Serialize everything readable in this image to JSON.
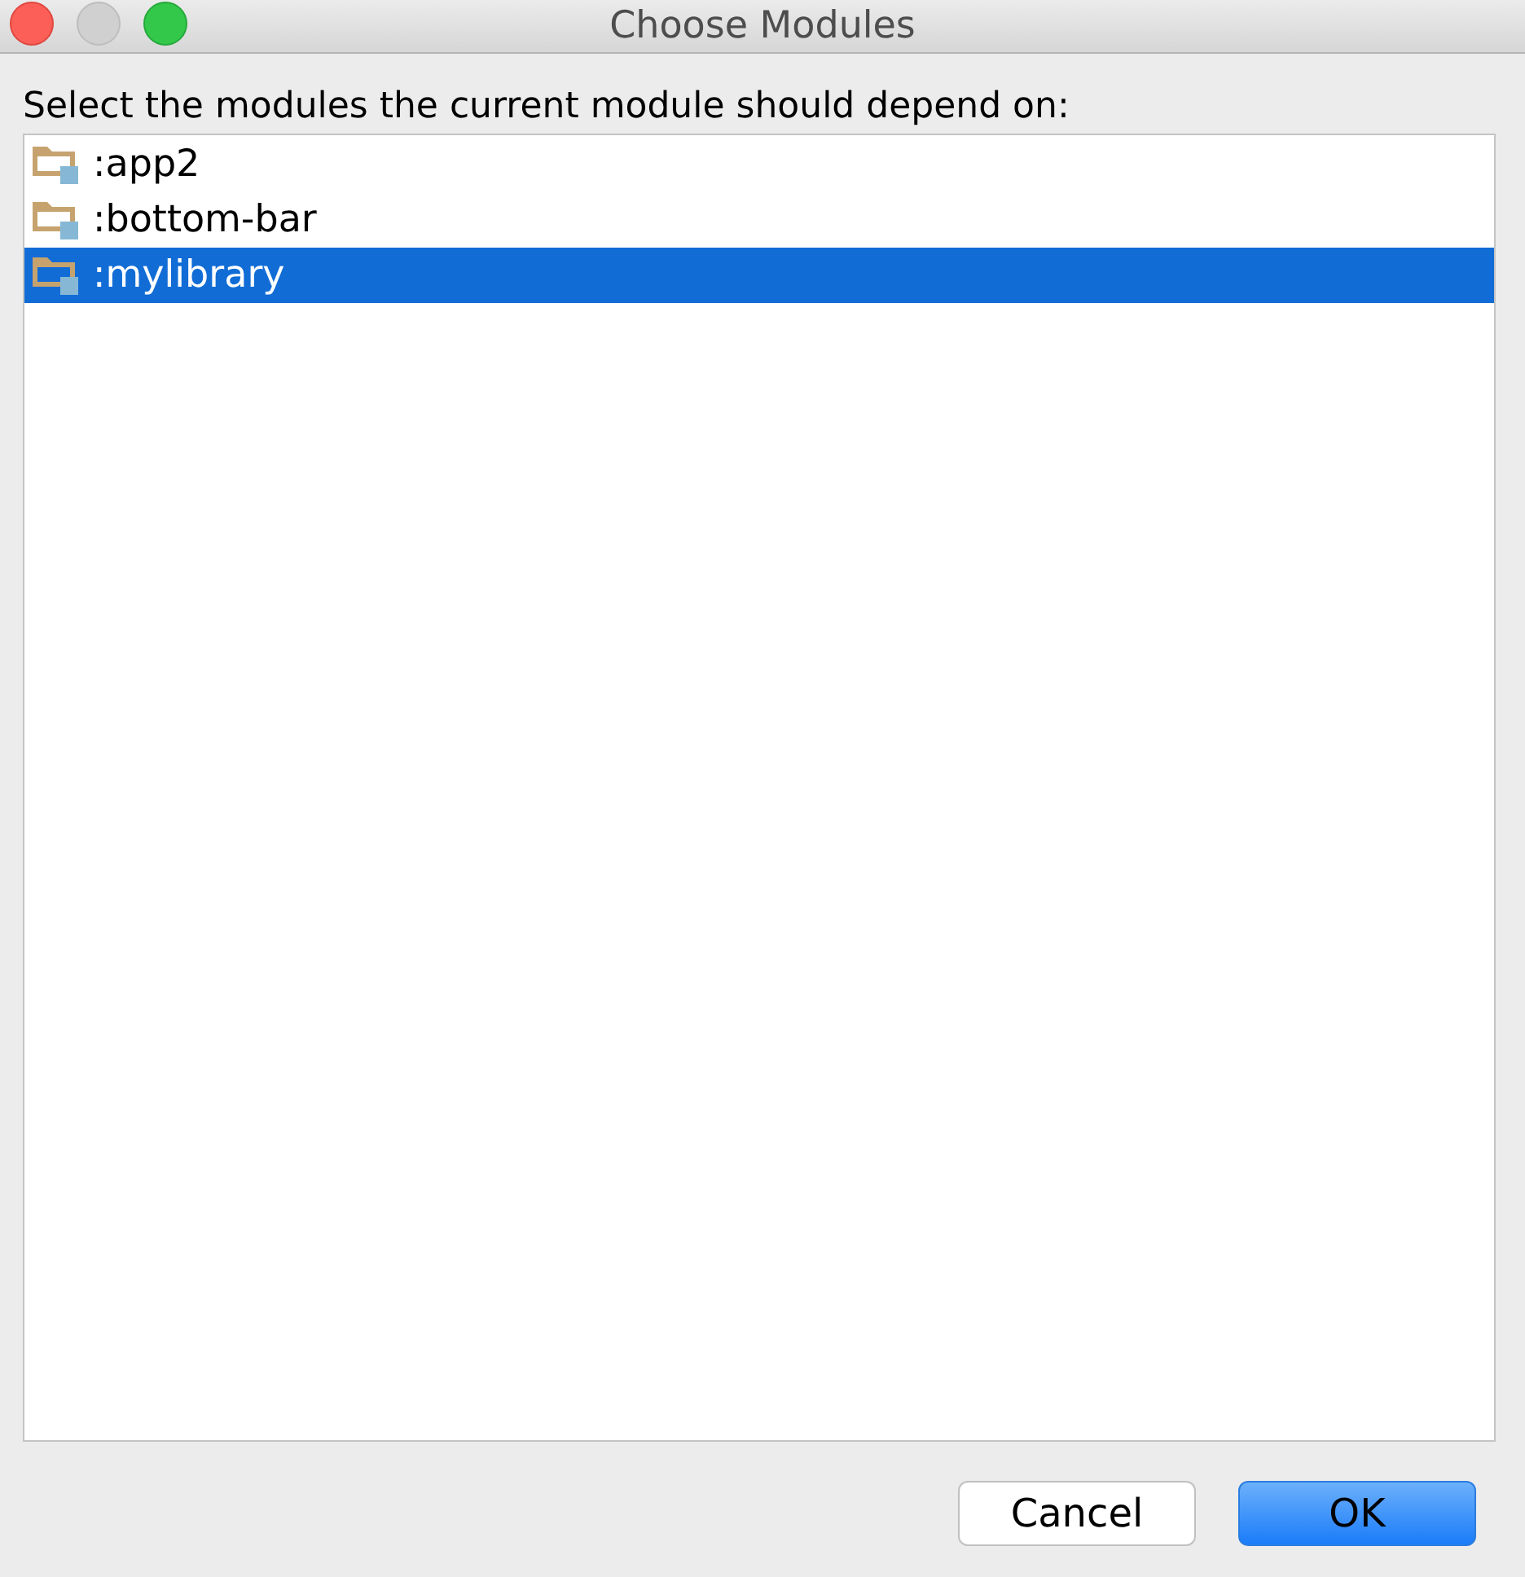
{
  "window": {
    "title": "Choose Modules"
  },
  "prompt": "Select the modules the current module should depend on:",
  "modules": [
    {
      "label": ":app2",
      "selected": false
    },
    {
      "label": ":bottom-bar",
      "selected": false
    },
    {
      "label": ":mylibrary",
      "selected": true
    }
  ],
  "buttons": [
    {
      "label": "Cancel",
      "kind": "secondary"
    },
    {
      "label": "OK",
      "kind": "default"
    }
  ]
}
